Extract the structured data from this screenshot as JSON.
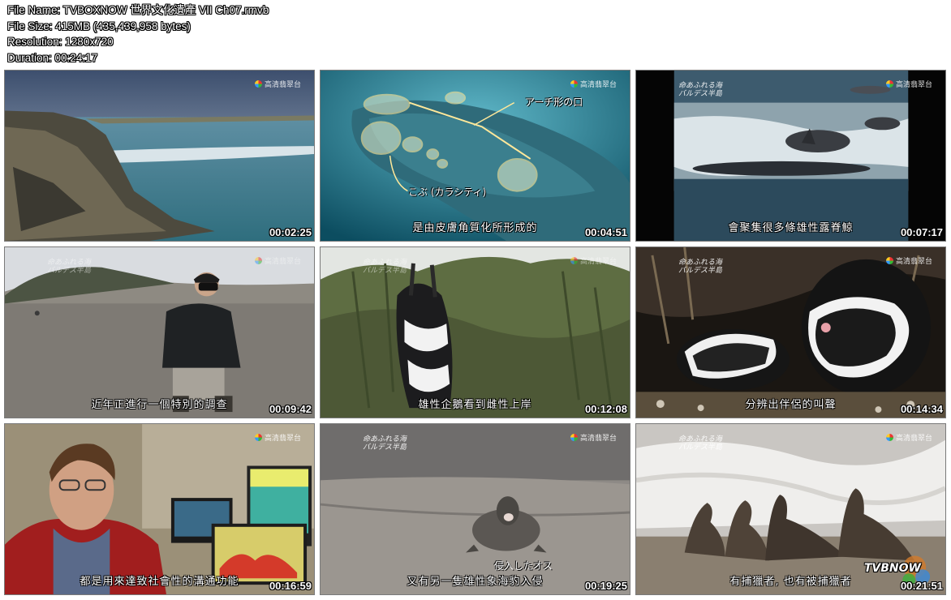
{
  "info": {
    "file_name": "File Name: TVBOXNOW 世界文化遺產 VII Ch07.rmvb",
    "file_size": "File Size: 415MB (435,439,958 bytes)",
    "resolution": "Resolution: 1280x720",
    "duration": "Duration: 00:24:17"
  },
  "channel_logo": "高清翡翠台",
  "jp_title_line1": "命あふれる海",
  "jp_title_line2": "バルデス半島",
  "thumbs": [
    {
      "time": "00:02:25",
      "subtitle": ""
    },
    {
      "time": "00:04:51",
      "subtitle": "是由皮膚角質化所形成的",
      "anno1": "アーチ形の口",
      "anno2": "こぶ (カラシティ)"
    },
    {
      "time": "00:07:17",
      "subtitle": "會聚集很多條雄性露脊鯨"
    },
    {
      "time": "00:09:42",
      "subtitle": "近年正進行一個特別的調查"
    },
    {
      "time": "00:12:08",
      "subtitle": "雄性企鵝看到雌性上岸"
    },
    {
      "time": "00:14:34",
      "subtitle": "分辨出伴侶的叫聲"
    },
    {
      "time": "00:16:59",
      "subtitle": "都是用來達致社會性的溝通功能"
    },
    {
      "time": "00:19:25",
      "subtitle": "又有另一隻雄性象海豹入侵",
      "anno1": "侵入したオス"
    },
    {
      "time": "00:21:51",
      "subtitle": "有捕獵者, 也有被捕獵者",
      "watermark": "TVBNOW"
    }
  ]
}
